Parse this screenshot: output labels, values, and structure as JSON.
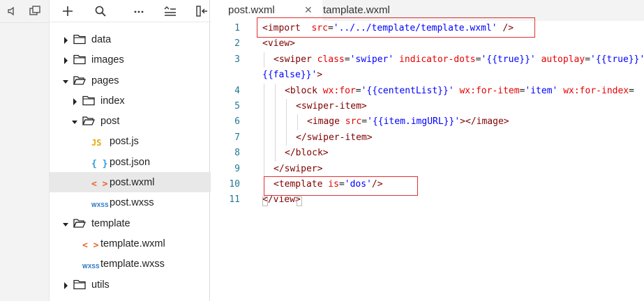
{
  "sidebar": {
    "tree": [
      {
        "label": "data",
        "type": "folder",
        "expanded": false,
        "depth": 0
      },
      {
        "label": "images",
        "type": "folder",
        "expanded": false,
        "depth": 0
      },
      {
        "label": "pages",
        "type": "folder",
        "expanded": true,
        "depth": 0
      },
      {
        "label": "index",
        "type": "folder",
        "expanded": false,
        "depth": 1
      },
      {
        "label": "post",
        "type": "folder",
        "expanded": true,
        "depth": 1
      },
      {
        "label": "post.js",
        "type": "js",
        "depth": 2,
        "badge": "JS"
      },
      {
        "label": "post.json",
        "type": "json",
        "depth": 2,
        "badge": "{ }"
      },
      {
        "label": "post.wxml",
        "type": "wxml",
        "depth": 2,
        "badge": "< >",
        "selected": true
      },
      {
        "label": "post.wxss",
        "type": "wxss",
        "depth": 2,
        "badge": "WXSS"
      },
      {
        "label": "template",
        "type": "folder",
        "expanded": true,
        "depth": 0
      },
      {
        "label": "template.wxml",
        "type": "wxml",
        "depth": 1,
        "badge": "< >"
      },
      {
        "label": "template.wxss",
        "type": "wxss",
        "depth": 1,
        "badge": "WXSS"
      },
      {
        "label": "utils",
        "type": "folder",
        "expanded": false,
        "depth": 0
      }
    ]
  },
  "editor": {
    "tabs": [
      {
        "label": "post.wxml",
        "active": true,
        "close": "✕"
      },
      {
        "label": "tamplate.wxml",
        "active": false
      }
    ],
    "lines": [
      {
        "num": "1",
        "indent": 0,
        "segs": [
          [
            "p",
            "<"
          ],
          [
            "t",
            "import"
          ],
          [
            "",
            "  "
          ],
          [
            "a",
            "src"
          ],
          [
            "",
            "="
          ],
          [
            "v",
            "'../../template/template.wxml'"
          ],
          [
            "",
            " "
          ],
          [
            "p",
            "/>"
          ]
        ]
      },
      {
        "num": "2",
        "indent": 0,
        "segs": [
          [
            "p",
            "<"
          ],
          [
            "t",
            "view"
          ],
          [
            "p",
            ">"
          ]
        ]
      },
      {
        "num": "3",
        "indent": 1,
        "segs": [
          [
            "p",
            "<"
          ],
          [
            "t",
            "swiper"
          ],
          [
            "",
            " "
          ],
          [
            "a",
            "class"
          ],
          [
            "",
            "="
          ],
          [
            "v",
            "'swiper'"
          ],
          [
            "",
            " "
          ],
          [
            "a",
            "indicator-dots"
          ],
          [
            "",
            "="
          ],
          [
            "v",
            "'{{true}}'"
          ],
          [
            "",
            " "
          ],
          [
            "a",
            "autoplay"
          ],
          [
            "",
            "="
          ],
          [
            "v",
            "'{{true}}'"
          ]
        ]
      },
      {
        "num": "",
        "indent": 0,
        "segs": [
          [
            "v",
            "{{false}}'"
          ],
          [
            "p",
            ">"
          ]
        ]
      },
      {
        "num": "4",
        "indent": 2,
        "segs": [
          [
            "p",
            "<"
          ],
          [
            "t",
            "block"
          ],
          [
            "",
            " "
          ],
          [
            "a",
            "wx:for"
          ],
          [
            "",
            "="
          ],
          [
            "v",
            "'{{cententList}}'"
          ],
          [
            "",
            " "
          ],
          [
            "a",
            "wx:for-item"
          ],
          [
            "",
            "="
          ],
          [
            "v",
            "'item'"
          ],
          [
            "",
            " "
          ],
          [
            "a",
            "wx:for-index"
          ],
          [
            "",
            "="
          ]
        ]
      },
      {
        "num": "5",
        "indent": 3,
        "segs": [
          [
            "p",
            "<"
          ],
          [
            "t",
            "swiper-item"
          ],
          [
            "p",
            ">"
          ]
        ]
      },
      {
        "num": "6",
        "indent": 4,
        "segs": [
          [
            "p",
            "<"
          ],
          [
            "t",
            "image"
          ],
          [
            "",
            " "
          ],
          [
            "a",
            "src"
          ],
          [
            "",
            "="
          ],
          [
            "v",
            "'{{item.imgURL}}'"
          ],
          [
            "p",
            "></"
          ],
          [
            "t",
            "image"
          ],
          [
            "p",
            ">"
          ]
        ]
      },
      {
        "num": "7",
        "indent": 3,
        "segs": [
          [
            "p",
            "</"
          ],
          [
            "t",
            "swiper-item"
          ],
          [
            "p",
            ">"
          ]
        ]
      },
      {
        "num": "8",
        "indent": 2,
        "segs": [
          [
            "p",
            "</"
          ],
          [
            "t",
            "block"
          ],
          [
            "p",
            ">"
          ]
        ]
      },
      {
        "num": "9",
        "indent": 1,
        "segs": [
          [
            "p",
            "</"
          ],
          [
            "t",
            "swiper"
          ],
          [
            "p",
            ">"
          ]
        ]
      },
      {
        "num": "10",
        "indent": 1,
        "segs": [
          [
            "p",
            "<"
          ],
          [
            "t",
            "template"
          ],
          [
            "",
            " "
          ],
          [
            "a",
            "is"
          ],
          [
            "",
            "="
          ],
          [
            "v",
            "'dos'"
          ],
          [
            "p",
            "/>"
          ]
        ]
      },
      {
        "num": "11",
        "indent": 0,
        "segs": [
          [
            "p",
            "</"
          ],
          [
            "t",
            "view"
          ],
          [
            "p",
            ">"
          ]
        ]
      }
    ]
  },
  "colors": {
    "highlight": "#e03030",
    "line_number": "#237893",
    "selected_row": "#e8e8e8"
  },
  "icons": [
    "speaker-icon",
    "window-icon",
    "plus-icon",
    "search-icon",
    "more-icon",
    "collapse-icon",
    "split-icon"
  ]
}
